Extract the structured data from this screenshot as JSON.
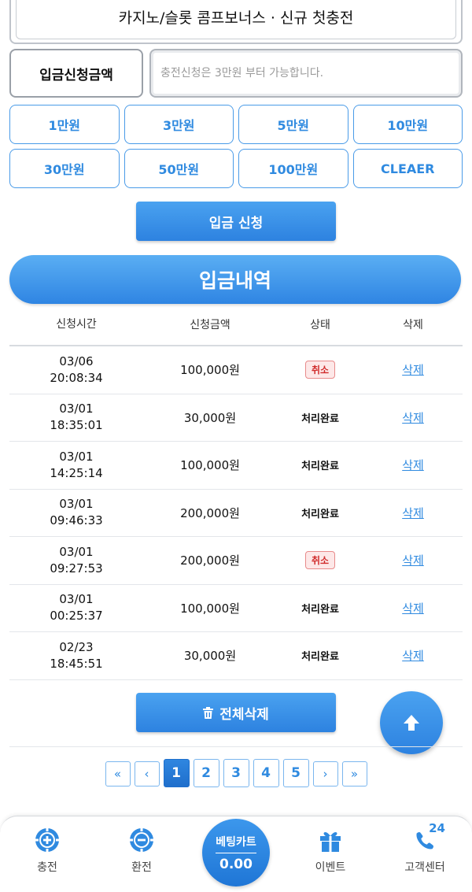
{
  "bonus": {
    "title": "카지노/슬롯 콤프보너스 · 신규 첫충전"
  },
  "amount": {
    "label": "입금신청금액",
    "placeholder": "충전신청은 3만원 부터 가능합니다."
  },
  "quick_amounts": [
    "1만원",
    "3만원",
    "5만원",
    "10만원",
    "30만원",
    "50만원",
    "100만원",
    "CLEAER"
  ],
  "deposit_button": "입금 신청",
  "history": {
    "title": "입금내역",
    "columns": [
      "신청시간",
      "신청금액",
      "상태",
      "삭제"
    ],
    "rows": [
      {
        "date": "03/06",
        "time": "20:08:34",
        "amount": "100,000원",
        "status": "취소",
        "delete": "삭제"
      },
      {
        "date": "03/01",
        "time": "18:35:01",
        "amount": "30,000원",
        "status": "처리완료",
        "delete": "삭제"
      },
      {
        "date": "03/01",
        "time": "14:25:14",
        "amount": "100,000원",
        "status": "처리완료",
        "delete": "삭제"
      },
      {
        "date": "03/01",
        "time": "09:46:33",
        "amount": "200,000원",
        "status": "처리완료",
        "delete": "삭제"
      },
      {
        "date": "03/01",
        "time": "09:27:53",
        "amount": "200,000원",
        "status": "취소",
        "delete": "삭제"
      },
      {
        "date": "03/01",
        "time": "00:25:37",
        "amount": "100,000원",
        "status": "처리완료",
        "delete": "삭제"
      },
      {
        "date": "02/23",
        "time": "18:45:51",
        "amount": "30,000원",
        "status": "처리완료",
        "delete": "삭제"
      }
    ]
  },
  "delete_all_button": "전체삭제",
  "pagination": {
    "first": "«",
    "prev": "‹",
    "pages": [
      "1",
      "2",
      "3",
      "4",
      "5"
    ],
    "current": "1",
    "next": "›",
    "last": "»"
  },
  "bottom_nav": {
    "charge": "충전",
    "exchange": "환전",
    "cart_label": "베팅카트",
    "cart_value": "0.00",
    "event": "이벤트",
    "support": "고객센터",
    "support_badge": "24"
  },
  "colors": {
    "accent": "#2f8ae0",
    "cancel": "#d02c2c"
  }
}
